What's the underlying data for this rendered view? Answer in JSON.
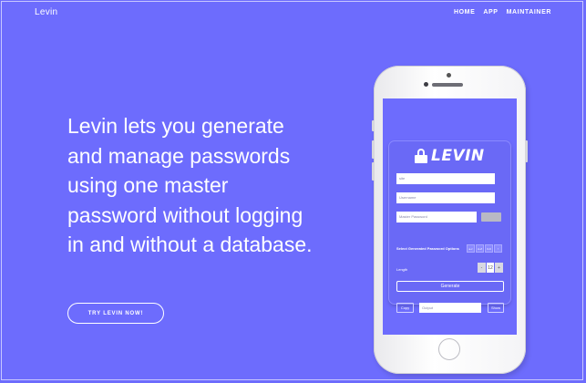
{
  "brand": {
    "name": "Levin"
  },
  "nav": {
    "home": "HOME",
    "app": "APP",
    "maintainer": "MAINTAINER"
  },
  "hero": {
    "headline": "Levin lets you generate and manage passwords using one master password without logging in and without a database.",
    "cta": "TRY LEVIN NOW!"
  },
  "app_preview": {
    "logo_text": "LEVIN",
    "site_placeholder": "site",
    "username_placeholder": "Username",
    "master_password_placeholder": "Master Password",
    "options_label": "Select Generated Password Options",
    "options": [
      "a-z",
      "A-Z",
      "0-9",
      "!"
    ],
    "length_label": "Length",
    "length_minus": "-",
    "length_value": "12",
    "length_plus": "+",
    "generate_label": "Generate",
    "copy_label": "Copy",
    "output_placeholder": "Output",
    "show_label": "Show"
  },
  "colors": {
    "background": "#6d6cfd",
    "text": "#ffffff"
  }
}
